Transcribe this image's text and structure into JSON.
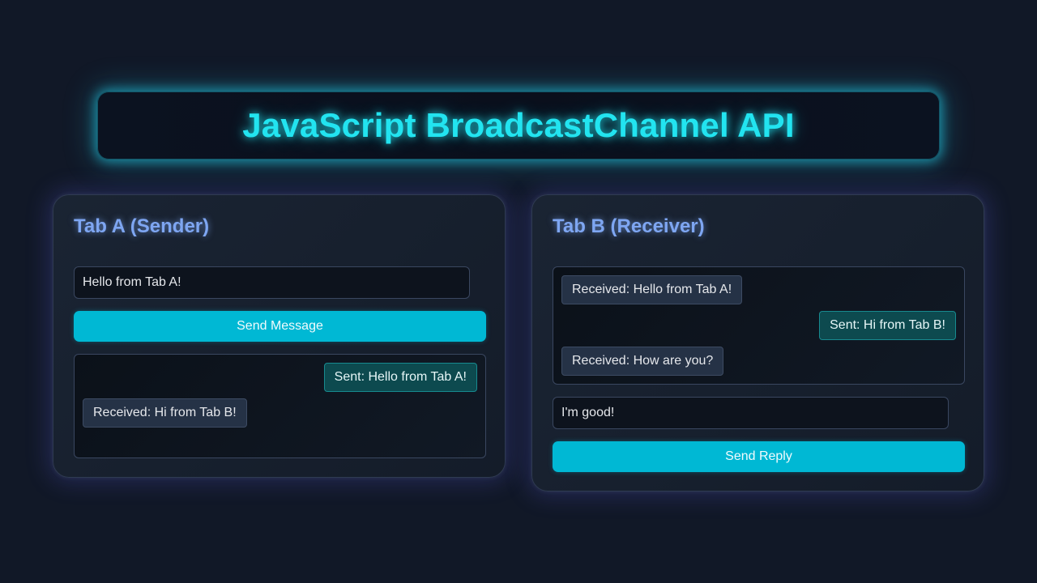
{
  "header": {
    "title": "JavaScript BroadcastChannel API"
  },
  "tab_a": {
    "title": "Tab A (Sender)",
    "input_value": "Hello from Tab A!",
    "send_label": "Send Message",
    "messages": [
      {
        "type": "sent",
        "text": "Sent: Hello from Tab A!"
      },
      {
        "type": "received",
        "text": "Received: Hi from Tab B!"
      }
    ]
  },
  "tab_b": {
    "title": "Tab B (Receiver)",
    "messages": [
      {
        "type": "received",
        "text": "Received: Hello from Tab A!"
      },
      {
        "type": "sent",
        "text": "Sent: Hi from Tab B!"
      },
      {
        "type": "received",
        "text": "Received: How are you?"
      }
    ],
    "input_value": "I'm good!",
    "send_label": "Send Reply"
  },
  "colors": {
    "background": "#111827",
    "accent_cyan": "#22e4f0",
    "button": "#00b8d4",
    "panel_title": "#7ea6f2",
    "sent_bubble": "#0d4a4f",
    "received_bubble": "#253246"
  }
}
